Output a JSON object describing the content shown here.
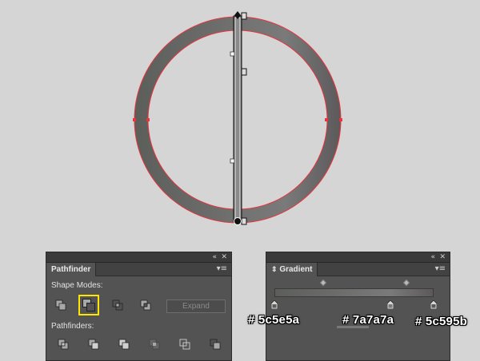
{
  "colors": {
    "canvas_bg": "#d5d5d5",
    "ring_outer": "#5c5e5a",
    "ring_mid": "#7a7a7a",
    "ring_inner": "#5c595b",
    "selection_red": "#e8343c",
    "panel_bg": "#535353",
    "highlight_yellow": "#ffe600"
  },
  "pathfinder": {
    "tab_label": "Pathfinder",
    "collapse_icon": "«",
    "close_icon": "✕",
    "menu_icon": "▾≡",
    "shape_modes_label": "Shape Modes:",
    "pathfinders_label": "Pathfinders:",
    "expand_label": "Expand",
    "shape_mode_buttons": [
      "unite",
      "minus-front",
      "intersect",
      "exclude"
    ],
    "selected_mode": "minus-front",
    "pathfinder_buttons": [
      "divide",
      "trim",
      "merge",
      "crop",
      "outline",
      "minus-back"
    ]
  },
  "gradient": {
    "tab_label": "Gradient",
    "tab_icon": "⇕",
    "collapse_icon": "«",
    "close_icon": "✕",
    "menu_icon": "▾≡",
    "stops": [
      {
        "color": "#5c5e5a",
        "label": "# 5c5e5a",
        "location": 0
      },
      {
        "color": "#7a7a7a",
        "label": "# 7a7a7a",
        "location": 0.73
      },
      {
        "color": "#5c595b",
        "label": "# 5c595b",
        "location": 1
      }
    ]
  }
}
